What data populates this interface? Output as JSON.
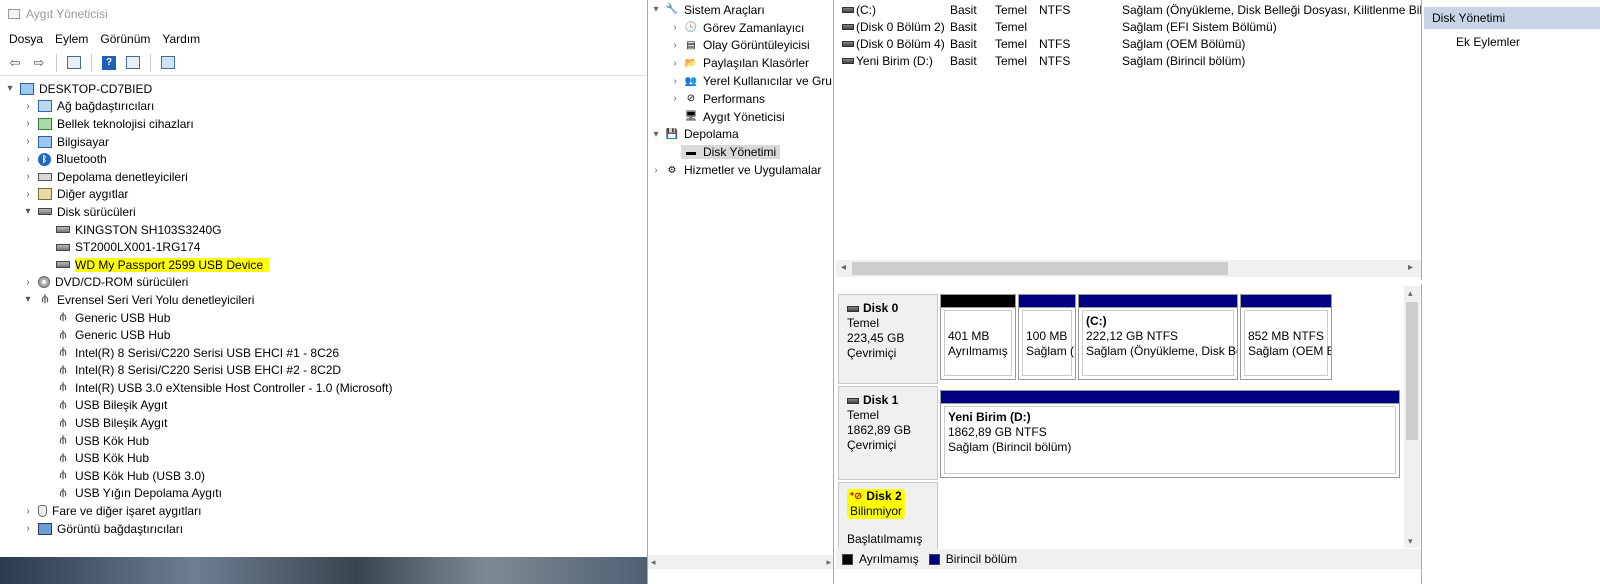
{
  "devmgr": {
    "title": "Aygıt Yöneticisi",
    "menu": [
      "Dosya",
      "Eylem",
      "Görünüm",
      "Yardım"
    ],
    "tree": [
      {
        "level": 0,
        "exp": "▾",
        "icon": "computer-icon",
        "cls": "ic-pc",
        "label": "DESKTOP-CD7BIED"
      },
      {
        "level": 1,
        "exp": "›",
        "icon": "network-adapter-icon",
        "cls": "ic-net",
        "label": "Ağ bağdaştırıcıları"
      },
      {
        "level": 1,
        "exp": "›",
        "icon": "memory-icon",
        "cls": "ic-mem",
        "label": "Bellek teknolojisi cihazları"
      },
      {
        "level": 1,
        "exp": "›",
        "icon": "computer-icon",
        "cls": "ic-pc",
        "label": "Bilgisayar"
      },
      {
        "level": 1,
        "exp": "›",
        "icon": "bluetooth-icon",
        "cls": "ic-bt",
        "label": "Bluetooth"
      },
      {
        "level": 1,
        "exp": "›",
        "icon": "storage-controller-icon",
        "cls": "ic-stor",
        "label": "Depolama denetleyicileri"
      },
      {
        "level": 1,
        "exp": "›",
        "icon": "other-device-icon",
        "cls": "ic-other",
        "label": "Diğer aygıtlar"
      },
      {
        "level": 1,
        "exp": "▾",
        "icon": "disk-drive-icon",
        "cls": "ic-disk",
        "label": "Disk sürücüleri"
      },
      {
        "level": 2,
        "exp": "",
        "icon": "disk-drive-icon",
        "cls": "ic-disk",
        "label": "KINGSTON SH103S3240G"
      },
      {
        "level": 2,
        "exp": "",
        "icon": "disk-drive-icon",
        "cls": "ic-disk",
        "label": "ST2000LX001-1RG174"
      },
      {
        "level": 2,
        "exp": "",
        "icon": "disk-drive-icon",
        "cls": "ic-disk",
        "label": "WD My Passport 2599 USB Device",
        "highlight": true
      },
      {
        "level": 1,
        "exp": "›",
        "icon": "dvd-icon",
        "cls": "ic-dvd",
        "label": "DVD/CD-ROM sürücüleri"
      },
      {
        "level": 1,
        "exp": "▾",
        "icon": "usb-icon",
        "cls": "ic-usb",
        "label": "Evrensel Seri Veri Yolu denetleyicileri"
      },
      {
        "level": 2,
        "exp": "",
        "icon": "usb-icon",
        "cls": "ic-usb",
        "label": "Generic USB Hub"
      },
      {
        "level": 2,
        "exp": "",
        "icon": "usb-icon",
        "cls": "ic-usb",
        "label": "Generic USB Hub"
      },
      {
        "level": 2,
        "exp": "",
        "icon": "usb-icon",
        "cls": "ic-usb",
        "label": "Intel(R) 8 Serisi/C220 Serisi USB EHCI #1 - 8C26"
      },
      {
        "level": 2,
        "exp": "",
        "icon": "usb-icon",
        "cls": "ic-usb",
        "label": "Intel(R) 8 Serisi/C220 Serisi USB EHCI #2 - 8C2D"
      },
      {
        "level": 2,
        "exp": "",
        "icon": "usb-icon",
        "cls": "ic-usb",
        "label": "Intel(R) USB 3.0 eXtensible Host Controller - 1.0 (Microsoft)"
      },
      {
        "level": 2,
        "exp": "",
        "icon": "usb-icon",
        "cls": "ic-usb",
        "label": "USB Bileşik Aygıt"
      },
      {
        "level": 2,
        "exp": "",
        "icon": "usb-icon",
        "cls": "ic-usb",
        "label": "USB Bileşik Aygıt"
      },
      {
        "level": 2,
        "exp": "",
        "icon": "usb-icon",
        "cls": "ic-usb",
        "label": "USB Kök Hub"
      },
      {
        "level": 2,
        "exp": "",
        "icon": "usb-icon",
        "cls": "ic-usb",
        "label": "USB Kök Hub"
      },
      {
        "level": 2,
        "exp": "",
        "icon": "usb-icon",
        "cls": "ic-usb",
        "label": "USB Kök Hub (USB 3.0)"
      },
      {
        "level": 2,
        "exp": "",
        "icon": "usb-icon",
        "cls": "ic-usb",
        "label": "USB Yığın Depolama Aygıtı"
      },
      {
        "level": 1,
        "exp": "›",
        "icon": "mouse-icon",
        "cls": "ic-mouse",
        "label": "Fare ve diğer işaret aygıtları"
      },
      {
        "level": 1,
        "exp": "›",
        "icon": "display-adapter-icon",
        "cls": "ic-display",
        "label": "Görüntü bağdaştırıcıları"
      }
    ]
  },
  "cmtree": [
    {
      "level": 0,
      "exp": "▾",
      "icon": "tools-icon",
      "glyph": "🔧",
      "label": "Sistem Araçları"
    },
    {
      "level": 1,
      "exp": "›",
      "icon": "task-scheduler-icon",
      "glyph": "🕓",
      "label": "Görev Zamanlayıcı"
    },
    {
      "level": 1,
      "exp": "›",
      "icon": "event-viewer-icon",
      "glyph": "▤",
      "label": "Olay Görüntüleyicisi"
    },
    {
      "level": 1,
      "exp": "›",
      "icon": "shared-folders-icon",
      "glyph": "📂",
      "label": "Paylaşılan Klasörler"
    },
    {
      "level": 1,
      "exp": "›",
      "icon": "users-icon",
      "glyph": "👥",
      "label": "Yerel Kullanıcılar ve Gru"
    },
    {
      "level": 1,
      "exp": "›",
      "icon": "performance-icon",
      "glyph": "⊘",
      "label": "Performans"
    },
    {
      "level": 1,
      "exp": "",
      "icon": "device-manager-icon",
      "glyph": "🖥",
      "label": "Aygıt Yöneticisi"
    },
    {
      "level": 0,
      "exp": "▾",
      "icon": "storage-icon",
      "glyph": "💾",
      "label": "Depolama"
    },
    {
      "level": 1,
      "exp": "",
      "icon": "disk-management-icon",
      "glyph": "▬",
      "label": "Disk Yönetimi",
      "selected": true
    },
    {
      "level": 0,
      "exp": "›",
      "icon": "services-icon",
      "glyph": "⚙",
      "label": "Hizmetler ve Uygulamalar"
    }
  ],
  "volumes": [
    {
      "name": "(C:)",
      "layout": "Basit",
      "type": "Temel",
      "fs": "NTFS",
      "status": "Sağlam (Önyükleme, Disk Belleği Dosyası, Kilitlenme Bilgis"
    },
    {
      "name": "(Disk 0 Bölüm 2)",
      "layout": "Basit",
      "type": "Temel",
      "fs": "",
      "status": "Sağlam (EFI Sistem Bölümü)"
    },
    {
      "name": "(Disk 0 Bölüm 4)",
      "layout": "Basit",
      "type": "Temel",
      "fs": "NTFS",
      "status": "Sağlam (OEM Bölümü)"
    },
    {
      "name": "Yeni Birim (D:)",
      "layout": "Basit",
      "type": "Temel",
      "fs": "NTFS",
      "status": "Sağlam (Birincil bölüm)"
    }
  ],
  "disks": {
    "disk0": {
      "name": "Disk 0",
      "type": "Temel",
      "size": "223,45 GB",
      "state": "Çevrimiçi",
      "parts": [
        {
          "line1": "",
          "line2": "401 MB",
          "line3": "Ayrılmamış"
        },
        {
          "line1": "",
          "line2": "100 MB",
          "line3": "Sağlam ("
        },
        {
          "line1": "(C:)",
          "line2": "222,12 GB NTFS",
          "line3": "Sağlam (Önyükleme, Disk Be"
        },
        {
          "line1": "",
          "line2": "852 MB NTFS",
          "line3": "Sağlam (OEM B"
        }
      ]
    },
    "disk1": {
      "name": "Disk 1",
      "type": "Temel",
      "size": "1862,89 GB",
      "state": "Çevrimiçi",
      "part": {
        "line1": "Yeni Birim  (D:)",
        "line2": "1862,89 GB NTFS",
        "line3": "Sağlam (Birincil bölüm)"
      }
    },
    "disk2": {
      "name": "Disk 2",
      "state": "Bilinmiyor",
      "init": "Başlatılmamış"
    }
  },
  "legend": {
    "unallocated": "Ayrılmamış",
    "primary": "Birincil bölüm"
  },
  "actions": {
    "header": "Disk Yönetimi",
    "more": "Ek Eylemler"
  },
  "colors": {
    "unallocated": "#000000",
    "primary": "#000080",
    "highlight": "#ffff00",
    "action_header": "#c8d5e6"
  }
}
